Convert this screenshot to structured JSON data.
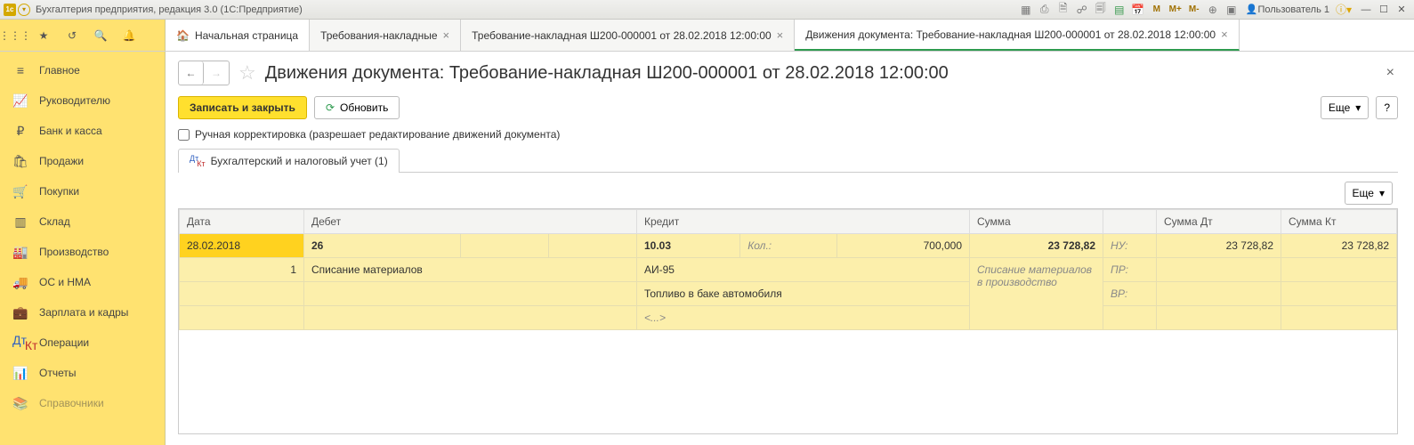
{
  "window": {
    "title": "Бухгалтерия предприятия, редакция 3.0  (1С:Предприятие)",
    "user": "Пользователь 1"
  },
  "topIcons": {
    "m1": "M",
    "m2": "M+",
    "m3": "M-"
  },
  "tabs": {
    "home": "Начальная страница",
    "t1": "Требования-накладные",
    "t2": "Требование-накладная Ш200-000001 от 28.02.2018 12:00:00",
    "t3": "Движения документа: Требование-накладная Ш200-000001 от 28.02.2018 12:00:00"
  },
  "sidebar": {
    "items": [
      {
        "label": "Главное"
      },
      {
        "label": "Руководителю"
      },
      {
        "label": "Банк и касса"
      },
      {
        "label": "Продажи"
      },
      {
        "label": "Покупки"
      },
      {
        "label": "Склад"
      },
      {
        "label": "Производство"
      },
      {
        "label": "ОС и НМА"
      },
      {
        "label": "Зарплата и кадры"
      },
      {
        "label": "Операции"
      },
      {
        "label": "Отчеты"
      },
      {
        "label": "Справочники"
      }
    ]
  },
  "page": {
    "title": "Движения документа: Требование-накладная Ш200-000001 от 28.02.2018 12:00:00",
    "saveClose": "Записать и закрыть",
    "refresh": "Обновить",
    "more": "Еще",
    "help": "?",
    "manualEdit": "Ручная корректировка (разрешает редактирование движений документа)",
    "subtab": "Бухгалтерский и налоговый учет (1)"
  },
  "grid": {
    "headers": {
      "date": "Дата",
      "debit": "Дебет",
      "credit": "Кредит",
      "sum": "Сумма",
      "sumDt": "Сумма Дт",
      "sumKt": "Сумма Кт"
    },
    "row1": {
      "date": "28.02.2018",
      "n": "1",
      "dAcc": "26",
      "kAcc": "10.03",
      "qtyLabel": "Кол.:",
      "qty": "700,000",
      "sum": "23 728,82",
      "nu": "НУ:",
      "sumDt": "23 728,82",
      "sumKt": "23 728,82",
      "dSub1": "Списание материалов",
      "kSub1": "АИ-95",
      "kSub2": "Топливо в баке автомобиля",
      "kSub3": "<...>",
      "content": "Списание материалов в производство",
      "pr": "ПР:",
      "vr": "ВР:"
    }
  }
}
